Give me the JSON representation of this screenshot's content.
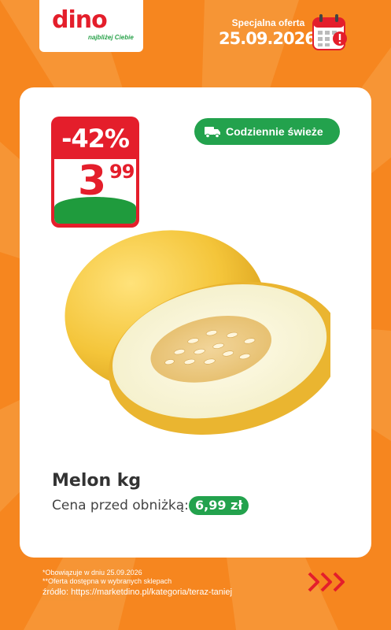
{
  "brand": {
    "logo": "dino",
    "tagline": "najbliżej Ciebie"
  },
  "header": {
    "offer_label": "Specjalna oferta",
    "offer_date": "25.09.2026",
    "calendar_icon": "calendar-alert-icon"
  },
  "product": {
    "discount": "-42%",
    "price_int": "3",
    "price_dec": "99",
    "badge": "Codziennie świeże",
    "badge_icon": "truck-icon",
    "name": "Melon kg",
    "prev_label": "Cena przed obniżką:",
    "prev_price": "6,99 zł"
  },
  "footer": {
    "line1": "*Obowiązuje w dniu 25.09.2026",
    "line2": "**Oferta dostępna w wybranych sklepach",
    "source": "źródło: https://marketdino.pl/kategoria/teraz-taniej",
    "arrows_icon": "triple-chevron-right-icon"
  },
  "colors": {
    "background": "#f6861f",
    "red": "#e41e2b",
    "green": "#23a24d",
    "white": "#ffffff"
  }
}
